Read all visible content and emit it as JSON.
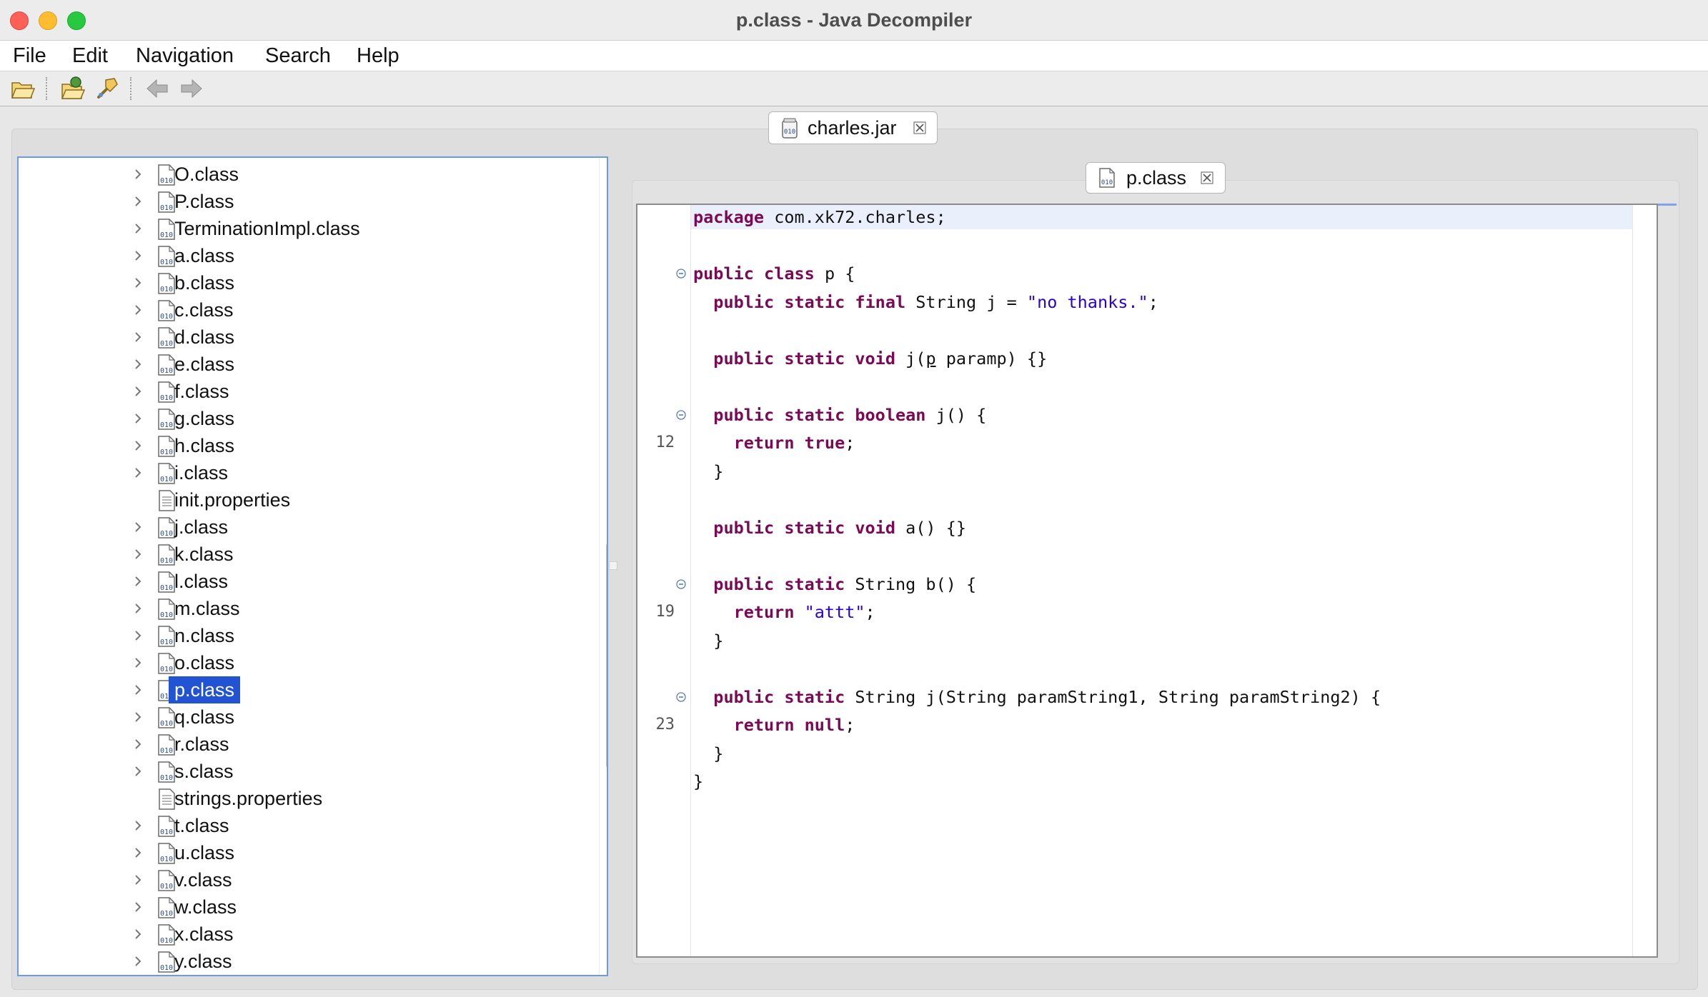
{
  "window": {
    "title": "p.class - Java Decompiler"
  },
  "menu": [
    "File",
    "Edit",
    "Navigation",
    "Search",
    "Help"
  ],
  "toolbar": {
    "buttons": [
      "open-file",
      "open-type",
      "search-type",
      "back",
      "forward"
    ]
  },
  "outer_tab": {
    "label": "charles.jar"
  },
  "editor_tab": {
    "label": "p.class"
  },
  "tree": {
    "items": [
      {
        "label": "O.class",
        "kind": "class"
      },
      {
        "label": "P.class",
        "kind": "class"
      },
      {
        "label": "TerminationImpl.class",
        "kind": "class"
      },
      {
        "label": "a.class",
        "kind": "class"
      },
      {
        "label": "b.class",
        "kind": "class"
      },
      {
        "label": "c.class",
        "kind": "class"
      },
      {
        "label": "d.class",
        "kind": "class"
      },
      {
        "label": "e.class",
        "kind": "class"
      },
      {
        "label": "f.class",
        "kind": "class"
      },
      {
        "label": "g.class",
        "kind": "class"
      },
      {
        "label": "h.class",
        "kind": "class"
      },
      {
        "label": "i.class",
        "kind": "class"
      },
      {
        "label": "init.properties",
        "kind": "file"
      },
      {
        "label": "j.class",
        "kind": "class"
      },
      {
        "label": "k.class",
        "kind": "class"
      },
      {
        "label": "l.class",
        "kind": "class"
      },
      {
        "label": "m.class",
        "kind": "class"
      },
      {
        "label": "n.class",
        "kind": "class"
      },
      {
        "label": "o.class",
        "kind": "class"
      },
      {
        "label": "p.class",
        "kind": "class",
        "selected": true
      },
      {
        "label": "q.class",
        "kind": "class"
      },
      {
        "label": "r.class",
        "kind": "class"
      },
      {
        "label": "s.class",
        "kind": "class"
      },
      {
        "label": "strings.properties",
        "kind": "file"
      },
      {
        "label": "t.class",
        "kind": "class"
      },
      {
        "label": "u.class",
        "kind": "class"
      },
      {
        "label": "v.class",
        "kind": "class"
      },
      {
        "label": "w.class",
        "kind": "class"
      },
      {
        "label": "x.class",
        "kind": "class"
      },
      {
        "label": "y.class",
        "kind": "class"
      }
    ]
  },
  "code": {
    "line_numbers": [
      "12",
      "19",
      "23"
    ],
    "lines": [
      [
        {
          "t": "package",
          "k": 1
        },
        {
          "t": " com.xk72.charles;"
        }
      ],
      [],
      [
        {
          "t": "public",
          "k": 1
        },
        {
          "t": " "
        },
        {
          "t": "class",
          "k": 1
        },
        {
          "t": " p {"
        }
      ],
      [
        {
          "t": "  "
        },
        {
          "t": "public",
          "k": 1
        },
        {
          "t": " "
        },
        {
          "t": "static",
          "k": 1
        },
        {
          "t": " "
        },
        {
          "t": "final",
          "k": 1
        },
        {
          "t": " String j = "
        },
        {
          "t": "\"no thanks.\"",
          "s": 1
        },
        {
          "t": ";"
        }
      ],
      [],
      [
        {
          "t": "  "
        },
        {
          "t": "public",
          "k": 1
        },
        {
          "t": " "
        },
        {
          "t": "static",
          "k": 1
        },
        {
          "t": " "
        },
        {
          "t": "void",
          "k": 1
        },
        {
          "t": " j("
        },
        {
          "t": "p",
          "u": 1
        },
        {
          "t": " paramp) {}"
        }
      ],
      [],
      [
        {
          "t": "  "
        },
        {
          "t": "public",
          "k": 1
        },
        {
          "t": " "
        },
        {
          "t": "static",
          "k": 1
        },
        {
          "t": " "
        },
        {
          "t": "boolean",
          "k": 1
        },
        {
          "t": " j() {"
        }
      ],
      [
        {
          "t": "    "
        },
        {
          "t": "return",
          "k": 1
        },
        {
          "t": " "
        },
        {
          "t": "true",
          "k": 1
        },
        {
          "t": ";"
        }
      ],
      [
        {
          "t": "  }"
        }
      ],
      [],
      [
        {
          "t": "  "
        },
        {
          "t": "public",
          "k": 1
        },
        {
          "t": " "
        },
        {
          "t": "static",
          "k": 1
        },
        {
          "t": " "
        },
        {
          "t": "void",
          "k": 1
        },
        {
          "t": " a() {}"
        }
      ],
      [],
      [
        {
          "t": "  "
        },
        {
          "t": "public",
          "k": 1
        },
        {
          "t": " "
        },
        {
          "t": "static",
          "k": 1
        },
        {
          "t": " String b() {"
        }
      ],
      [
        {
          "t": "    "
        },
        {
          "t": "return",
          "k": 1
        },
        {
          "t": " "
        },
        {
          "t": "\"attt\"",
          "s": 1
        },
        {
          "t": ";"
        }
      ],
      [
        {
          "t": "  }"
        }
      ],
      [],
      [
        {
          "t": "  "
        },
        {
          "t": "public",
          "k": 1
        },
        {
          "t": " "
        },
        {
          "t": "static",
          "k": 1
        },
        {
          "t": " String j(String paramString1, String paramString2) {"
        }
      ],
      [
        {
          "t": "    "
        },
        {
          "t": "return",
          "k": 1
        },
        {
          "t": " "
        },
        {
          "t": "null",
          "k": 1
        },
        {
          "t": ";"
        }
      ],
      [
        {
          "t": "  }"
        }
      ],
      [
        {
          "t": "}"
        }
      ]
    ]
  },
  "colors": {
    "keyword": "#7a0a55",
    "string": "#2a00d8",
    "selection": "#2153d3",
    "tree_border": "#6b9be0"
  }
}
